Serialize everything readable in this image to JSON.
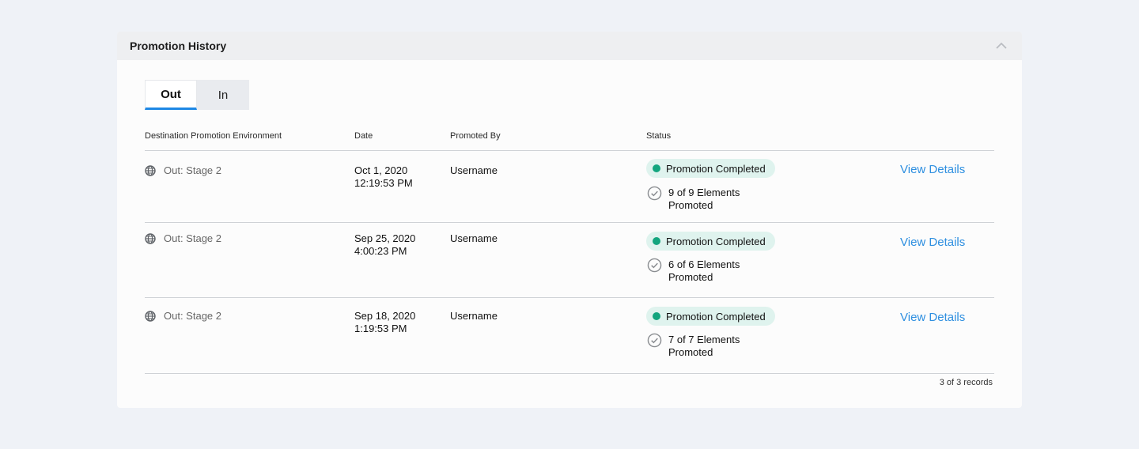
{
  "panel": {
    "title": "Promotion History"
  },
  "tabs": [
    {
      "label": "Out",
      "active": true
    },
    {
      "label": "In",
      "active": false
    }
  ],
  "table": {
    "headers": {
      "environment": "Destination Promotion Environment",
      "date": "Date",
      "promoted_by": "Promoted By",
      "status": "Status"
    },
    "rows": [
      {
        "environment": "Out: Stage 2",
        "date_line1": "Oct 1, 2020",
        "date_line2": "12:19:53 PM",
        "promoted_by": "Username",
        "status": "Promotion Completed",
        "elements_line1": "9 of 9 Elements",
        "elements_line2": "Promoted",
        "action": "View Details"
      },
      {
        "environment": "Out: Stage 2",
        "date_line1": "Sep 25, 2020",
        "date_line2": "4:00:23 PM",
        "promoted_by": "Username",
        "status": "Promotion Completed",
        "elements_line1": "6 of 6 Elements",
        "elements_line2": "Promoted",
        "action": "View Details"
      },
      {
        "environment": "Out: Stage 2",
        "date_line1": "Sep 18, 2020",
        "date_line2": "1:19:53 PM",
        "promoted_by": "Username",
        "status": "Promotion Completed",
        "elements_line1": "7 of 7 Elements",
        "elements_line2": "Promoted",
        "action": "View Details"
      }
    ],
    "footer": "3 of 3 records"
  },
  "icons": {
    "collapse": "chevron-up-icon",
    "environment": "globe-icon",
    "elements": "check-circle-icon"
  },
  "colors": {
    "accent": "#1e88e5",
    "link": "#2e8fe0",
    "status_dot": "#13a57e",
    "status_bg": "#dff3ee"
  }
}
